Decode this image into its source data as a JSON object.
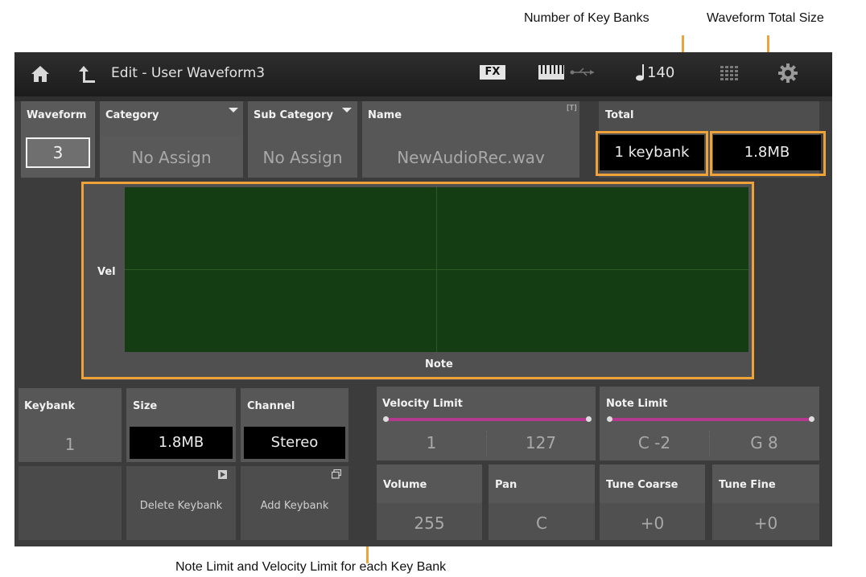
{
  "annotations": {
    "key_banks": "Number of Key Banks",
    "total_size": "Waveform Total Size",
    "limits": "Note Limit and Velocity Limit for each Key Bank"
  },
  "titlebar": {
    "title": "Edit - User Waveform3",
    "fx_label": "FX",
    "tempo": "140"
  },
  "waveform": {
    "label": "Waveform",
    "value": "3"
  },
  "category": {
    "label": "Category",
    "value": "No Assign"
  },
  "sub_category": {
    "label": "Sub Category",
    "value": "No Assign"
  },
  "name": {
    "label": "Name",
    "value": "NewAudioRec.wav",
    "badge": "[T]"
  },
  "total": {
    "label": "Total",
    "keybanks": "1 keybank",
    "size": "1.8MB"
  },
  "graph": {
    "y_label": "Vel",
    "x_label": "Note"
  },
  "keybank": {
    "label": "Keybank",
    "value": "1"
  },
  "size": {
    "label": "Size",
    "value": "1.8MB"
  },
  "channel": {
    "label": "Channel",
    "value": "Stereo"
  },
  "buttons": {
    "delete_keybank": "Delete Keybank",
    "add_keybank": "Add Keybank"
  },
  "velocity_limit": {
    "label": "Velocity Limit",
    "low": "1",
    "high": "127"
  },
  "note_limit": {
    "label": "Note Limit",
    "low": "C -2",
    "high": "G 8"
  },
  "volume": {
    "label": "Volume",
    "value": "255"
  },
  "pan": {
    "label": "Pan",
    "value": "C"
  },
  "tune_coarse": {
    "label": "Tune Coarse",
    "value": "+0"
  },
  "tune_fine": {
    "label": "Tune Fine",
    "value": "+0"
  },
  "colors": {
    "accent_orange": "#f0a23a",
    "graph_green": "#153d13",
    "slider_magenta": "#b33a8f"
  },
  "icons": [
    "home-icon",
    "back-icon",
    "keyboard-icon",
    "usb-icon",
    "note-icon",
    "grid-icon",
    "gear-icon",
    "play-icon",
    "window-icon"
  ]
}
